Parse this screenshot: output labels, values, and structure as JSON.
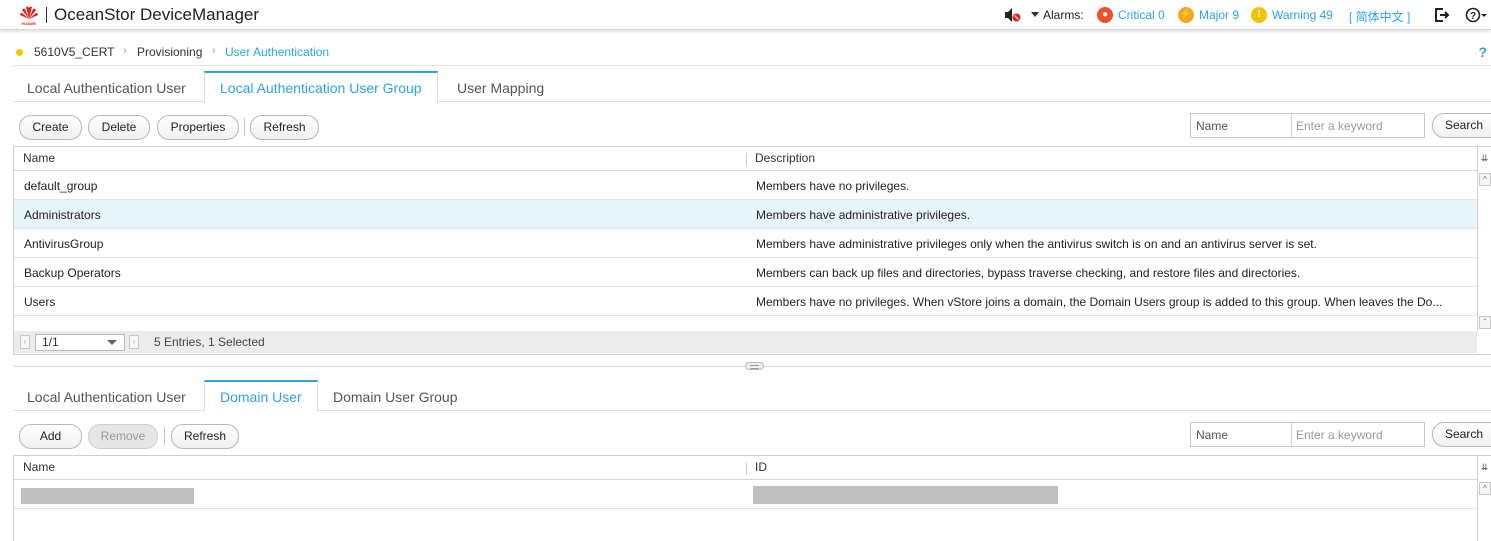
{
  "header": {
    "brand": "HUAWEI",
    "app_title": "OceanStor DeviceManager",
    "alarms_label": "Alarms:",
    "critical": "Critical 0",
    "major": "Major 9",
    "warning": "Warning 49",
    "language": "[ 简体中文 ]",
    "colors": {
      "critical": "#f2502d",
      "major": "#f5a623",
      "warning": "#f5c400",
      "link": "#29a3e6"
    }
  },
  "breadcrumb": {
    "device": "5610V5_CERT",
    "section": "Provisioning",
    "page": "User Authentication",
    "help": "?"
  },
  "top_panel": {
    "tabs": [
      "Local Authentication User",
      "Local Authentication User Group",
      "User Mapping"
    ],
    "active_tab": 1,
    "buttons": {
      "create": "Create",
      "delete": "Delete",
      "properties": "Properties",
      "refresh": "Refresh"
    },
    "search": {
      "field_label": "Name",
      "placeholder": "Enter a keyword",
      "button": "Search"
    },
    "columns": [
      "Name",
      "Description"
    ],
    "rows": [
      {
        "name": "default_group",
        "description": "Members have no privileges."
      },
      {
        "name": "Administrators",
        "description": "Members have administrative privileges."
      },
      {
        "name": "AntivirusGroup",
        "description": "Members have administrative privileges only when the antivirus switch is on and an antivirus server is set."
      },
      {
        "name": "Backup Operators",
        "description": "Members can back up files and directories, bypass traverse checking, and restore files and directories."
      },
      {
        "name": "Users",
        "description": "Members have no privileges. When vStore joins a domain, the Domain Users group is added to this group. When leaves the Do..."
      }
    ],
    "selected_row": 1,
    "pager": {
      "page": "1/1",
      "info": "5 Entries, 1 Selected"
    }
  },
  "bottom_panel": {
    "tabs": [
      "Local Authentication User",
      "Domain User",
      "Domain User Group"
    ],
    "active_tab": 1,
    "buttons": {
      "add": "Add",
      "remove": "Remove",
      "refresh": "Refresh"
    },
    "search": {
      "field_label": "Name",
      "placeholder": "Enter a keyword",
      "button": "Search"
    },
    "columns": [
      "Name",
      "ID"
    ]
  }
}
